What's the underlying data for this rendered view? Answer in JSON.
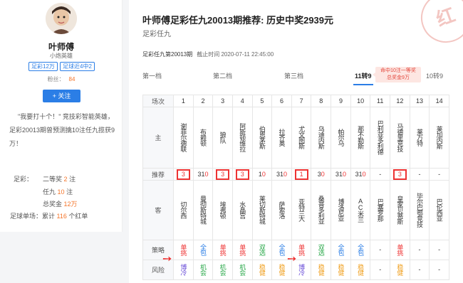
{
  "expert": {
    "name": "叶师傅",
    "subtitle": "小炮英雄",
    "tags": [
      "足彩12万",
      "足球近4中2"
    ],
    "fans_label": "粉丝：",
    "fans_count": "84",
    "follow_label": "+ 关注",
    "quote": "\"我要打十个！\" 竞技彩智能英雄，足彩20013期曾预测擒10注任九揽获9万！",
    "stats": {
      "zc_label": "足彩：",
      "zc_1_pre": "二等奖",
      "zc_1_num": "2",
      "zc_1_post": "注",
      "zc_2_pre": "任九",
      "zc_2_num": "10",
      "zc_2_post": "注",
      "zc_3_pre": "总奖金",
      "zc_3_num": "12万",
      "single_label": "足球单场：",
      "single_pre": "累计",
      "single_num": "116",
      "single_post": "个红单"
    }
  },
  "stamp": "红",
  "main": {
    "title": "叶师傅足彩任九20013期推荐: 历史中奖2939元",
    "subtitle": "足彩任九",
    "issue": "足彩任九第20013期",
    "deadline": "截止时间 2020-07-11 22:45:00",
    "tiers": [
      "第一档",
      "第二档",
      "第三档",
      "11转9",
      "10转9"
    ],
    "bubble_line1": "命中10注一等奖",
    "bubble_line2": "总奖金9万"
  },
  "table": {
    "labels": {
      "order": "场次",
      "home": "主",
      "pick": "推荐",
      "away": "客",
      "strategy": "策略",
      "risk": "风险"
    },
    "matches": [
      {
        "no": "1",
        "home": "谢菲尔德联",
        "pick": "3",
        "hl": true,
        "away": "切尔西",
        "strategy": "单挑",
        "s_color": "red",
        "risk": "博冷",
        "r_color": "purple"
      },
      {
        "no": "2",
        "home": "布赖顿",
        "pick": "310",
        "hl": false,
        "away": "曼彻斯特城",
        "strategy": "全包",
        "s_color": "blue",
        "risk": "机会",
        "r_color": "green"
      },
      {
        "no": "3",
        "home": "狼队",
        "pick": "3",
        "hl": true,
        "away": "埃弗顿",
        "strategy": "单挑",
        "s_color": "red",
        "risk": "机会",
        "r_color": "green"
      },
      {
        "no": "4",
        "home": "阿斯顿维拉",
        "pick": "3",
        "hl": true,
        "away": "水晶宫",
        "strategy": "单挑",
        "s_color": "red",
        "risk": "机会",
        "r_color": "green"
      },
      {
        "no": "5",
        "home": "伯恩茅斯",
        "pick": "10",
        "hl": false,
        "away": "莱切斯特城",
        "strategy": "双选",
        "s_color": "green",
        "risk": "稳健",
        "r_color": "orange"
      },
      {
        "no": "6",
        "home": "拉齐奥",
        "pick": "310",
        "hl": false,
        "away": "萨索洛",
        "strategy": "全包",
        "s_color": "blue",
        "risk": "稳健",
        "r_color": "orange"
      },
      {
        "no": "7",
        "home": "尤文图斯",
        "pick": "1",
        "hl": true,
        "away": "亚特兰大",
        "strategy": "单挑",
        "s_color": "red",
        "risk": "博冷",
        "r_color": "purple"
      },
      {
        "no": "8",
        "home": "乌迪内斯",
        "pick": "30",
        "hl": false,
        "away": "桑普多利亚",
        "strategy": "双选",
        "s_color": "green",
        "risk": "稳健",
        "r_color": "orange"
      },
      {
        "no": "9",
        "home": "帕尔马",
        "pick": "310",
        "hl": false,
        "away": "博洛尼亚",
        "strategy": "全包",
        "s_color": "blue",
        "risk": "稳健",
        "r_color": "orange"
      },
      {
        "no": "10",
        "home": "那不勒斯",
        "pick": "310",
        "hl": false,
        "away": "AC米兰",
        "strategy": "全包",
        "s_color": "blue",
        "risk": "稳健",
        "r_color": "orange"
      },
      {
        "no": "11",
        "home": "巴利亚多利德",
        "pick": "-",
        "hl": false,
        "away": "巴塞罗那",
        "strategy": "-",
        "s_color": "none",
        "risk": "-",
        "r_color": "none"
      },
      {
        "no": "12",
        "home": "马德里竞技",
        "pick": "3",
        "hl": true,
        "away": "皇家贝蒂斯",
        "strategy": "单挑",
        "s_color": "red",
        "risk": "稳健",
        "r_color": "orange"
      },
      {
        "no": "13",
        "home": "莱万特",
        "pick": "-",
        "hl": false,
        "away": "毕尔巴鄂竞技",
        "strategy": "-",
        "s_color": "none",
        "risk": "-",
        "r_color": "none"
      },
      {
        "no": "14",
        "home": "莱加内斯",
        "pick": "-",
        "hl": false,
        "away": "巴伦西亚",
        "strategy": "-",
        "s_color": "none",
        "risk": "-",
        "r_color": "none"
      }
    ]
  }
}
